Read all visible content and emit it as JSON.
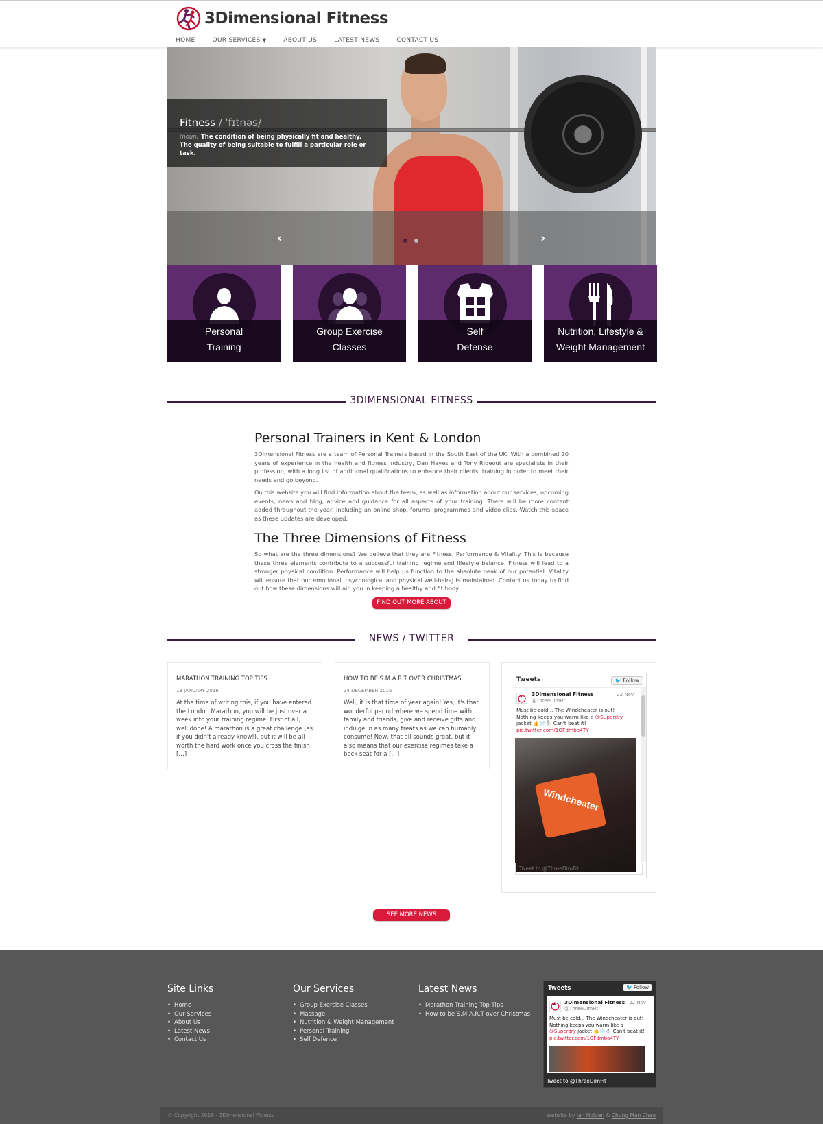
{
  "header": {
    "logo_text": "3Dimensional Fitness",
    "nav": [
      {
        "label": "HOME"
      },
      {
        "label": "OUR SERVICES",
        "has_dropdown": true
      },
      {
        "label": "ABOUT US"
      },
      {
        "label": "LATEST NEWS"
      },
      {
        "label": "CONTACT US"
      }
    ]
  },
  "hero": {
    "caption_title": "Fitness",
    "caption_phonetic": "/ ˈfɪtnəs/",
    "caption_noun": "(noun)",
    "caption_text": "The condition of being physically fit and healthy. The quality of being suitable to fulfill a particular role or task.",
    "slide_count": 2,
    "active_slide": 1
  },
  "services": [
    {
      "line1": "Personal",
      "line2": "Training",
      "icon": "person-icon"
    },
    {
      "line1": "Group Exercise",
      "line2": "Classes",
      "icon": "group-icon"
    },
    {
      "line1": "Self",
      "line2": "Defense",
      "icon": "protective-vest-icon"
    },
    {
      "line1": "Nutrition, Lifestyle &",
      "line2": "Weight Management",
      "icon": "fork-knife-icon"
    }
  ],
  "about": {
    "section_title": "3DIMENSIONAL FITNESS",
    "heading1": "Personal Trainers in Kent & London",
    "para1": "3Dimensional Fitness are a team of Personal Trainers based in the South East of the UK. With a combined 20 years of experience in the health and fitness industry, Dan Hayes and Tony Rideout are specialists in their profession, with a long list of additional qualifications to enhance their clients' training in order to meet their needs and go beyond.",
    "para2": "On this website you will find information about the team, as well as information about our services, upcoming events, news and blog, advice and guidance for all aspects of your training. There will be more content added throughout the year, including an online shop, forums, programmes and video clips. Watch this space as these updates are developed.",
    "heading2": "The Three Dimensions of Fitness",
    "para3": "So what are the three dimensions? We believe that they are Fitness, Performance & Vitality. This is because these three elements contribute to a successful training regime and lifestyle balance. Fitness will lead to a stronger physical condition. Performance will help us function to the absolute peak of our potential. Vitality will ensure that our emotional, psychological and physical well-being is maintained.  Contact us today to find out how these dimensions will aid you in keeping a healthy and fit body.",
    "button": "FIND OUT MORE ABOUT US"
  },
  "news": {
    "section_title": "NEWS / TWITTER",
    "articles": [
      {
        "title": "MARATHON TRAINING TOP TIPS",
        "date": "13 JANUARY 2016",
        "excerpt": "At the time of writing this, if you have entered the London Marathon, you will be just over a week into your training regime. First of all, well done! A marathon is a great challenge (as if you didn't already know!), but it will be all worth the hard work once you cross the finish […]"
      },
      {
        "title": "HOW TO BE S.M.A.R.T OVER CHRISTMAS",
        "date": "24 DECEMBER 2015",
        "excerpt": "Well, it is that time of year again! Yes, it's that wonderful period where we spend time with family and friends, give and receive gifts and indulge in as many treats as we can humanly consume! Now, that all sounds great, but it also means that our exercise regimes take a back seat for a […]"
      }
    ],
    "button": "SEE MORE NEWS ARTICLES"
  },
  "twitter": {
    "title": "Tweets",
    "follow": "Follow",
    "name": "3Dimensional Fitness",
    "handle": "@ThreeDimFit",
    "date": "22 Nov",
    "text_before": "Must be cold... The Windcheater is out! Nothing keeps you warm like a ",
    "mention": "@Superdry",
    "text_after": " jacket 👍❄️⛄ Can't beat it! ",
    "link": "pic.twitter.com/1OFdmbo4TY",
    "photo_text": "Windcheater",
    "compose": "Tweet to @ThreeDimFit"
  },
  "footer": {
    "site_links": {
      "title": "Site Links",
      "items": [
        "Home",
        "Our Services",
        "About Us",
        "Latest News",
        "Contact Us"
      ]
    },
    "our_services": {
      "title": "Our Services",
      "items": [
        "Group Exercise Classes",
        "Massage",
        "Nutrition & Weight Management",
        "Personal Training",
        "Self Defence"
      ]
    },
    "latest_news": {
      "title": "Latest News",
      "items": [
        "Marathon Training Top Tips",
        "How to be S.M.A.R.T over Christmas"
      ]
    },
    "copyright": "© Copyright 2016 - 3Dimensional Fitness",
    "credit_prefix": "Website by",
    "credit_name1": "Ian Holden",
    "credit_amp": "&",
    "credit_name2": "Chung Man Chau"
  },
  "colors": {
    "purple": "#5e2b6e",
    "dark_purple": "#3a1a40",
    "red": "#d81b3a",
    "footer_gray": "#575757"
  }
}
